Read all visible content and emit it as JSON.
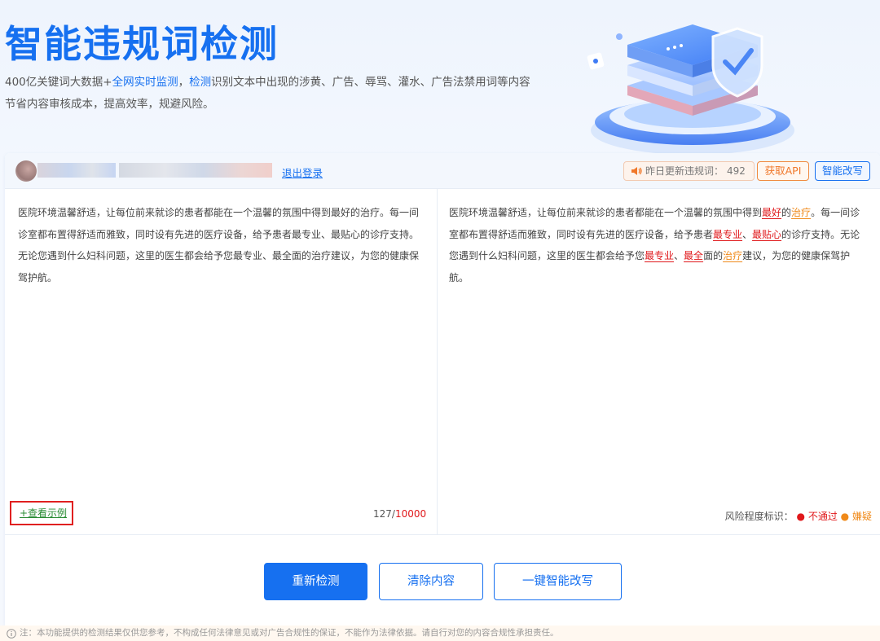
{
  "hero": {
    "title": "智能违规词检测",
    "desc_line1_p1": "400亿关键词大数据+",
    "desc_line1_hl1": "全网实时监测",
    "desc_line1_p2": "，",
    "desc_line1_hl2": "检测",
    "desc_line1_p3": "识别文本中出现的涉黄、广告、辱骂、灌水、广告法禁用词等内容",
    "desc_line2": "节省内容审核成本，提高效率，规避风险。"
  },
  "userbar": {
    "logout": "退出登录",
    "update_label": "昨日更新违规词：",
    "update_count": "492",
    "api_button": "获取API",
    "rewrite_button": "智能改写"
  },
  "input_panel": {
    "text": "医院环境温馨舒适，让每位前来就诊的患者都能在一个温馨的氛围中得到最好的治疗。每一间诊室都布置得舒适而雅致，同时设有先进的医疗设备，给予患者最专业、最贴心的诊疗支持。无论您遇到什么妇科问题，这里的医生都会给予您最专业、最全面的治疗建议，为您的健康保驾护航。",
    "example_link": "+查看示例",
    "count": "127",
    "count_sep": "/",
    "count_max": "10000"
  },
  "result_panel": {
    "segments": [
      {
        "t": "医院环境温馨舒适，让每位前来就诊的患者都能在一个温馨的氛围中得到",
        "k": "n"
      },
      {
        "t": "最好",
        "k": "r"
      },
      {
        "t": "的",
        "k": "n"
      },
      {
        "t": "治疗",
        "k": "o"
      },
      {
        "t": "。每一间诊室都布置得舒适而雅致，同时设有先进的医疗设备，给予患者",
        "k": "n"
      },
      {
        "t": "最专业",
        "k": "r"
      },
      {
        "t": "、",
        "k": "n"
      },
      {
        "t": "最贴心",
        "k": "r"
      },
      {
        "t": "的诊疗支持。无论您遇到什么妇科问题，这里的医生都会给予您",
        "k": "n"
      },
      {
        "t": "最专业",
        "k": "r"
      },
      {
        "t": "、",
        "k": "n"
      },
      {
        "t": "最全",
        "k": "r"
      },
      {
        "t": "面的",
        "k": "n"
      },
      {
        "t": "治疗",
        "k": "o"
      },
      {
        "t": "建议，为您的健康保驾护航。",
        "k": "n"
      }
    ],
    "risk_label": "风险程度标识：",
    "risk_fail": "不通过",
    "risk_suspect": "嫌疑",
    "color_fail": "#e0181b",
    "color_suspect": "#f08a1a"
  },
  "actions": {
    "recheck": "重新检测",
    "clear": "清除内容",
    "smart_rewrite": "一键智能改写"
  },
  "footnote": "注：本功能提供的检测结果仅供您参考，不构成任何法律意见或对广告合规性的保证，不能作为法律依据。请自行对您的内容合规性承担责任。",
  "colors": {
    "primary": "#1670f0",
    "accent_orange": "#f0782a"
  }
}
